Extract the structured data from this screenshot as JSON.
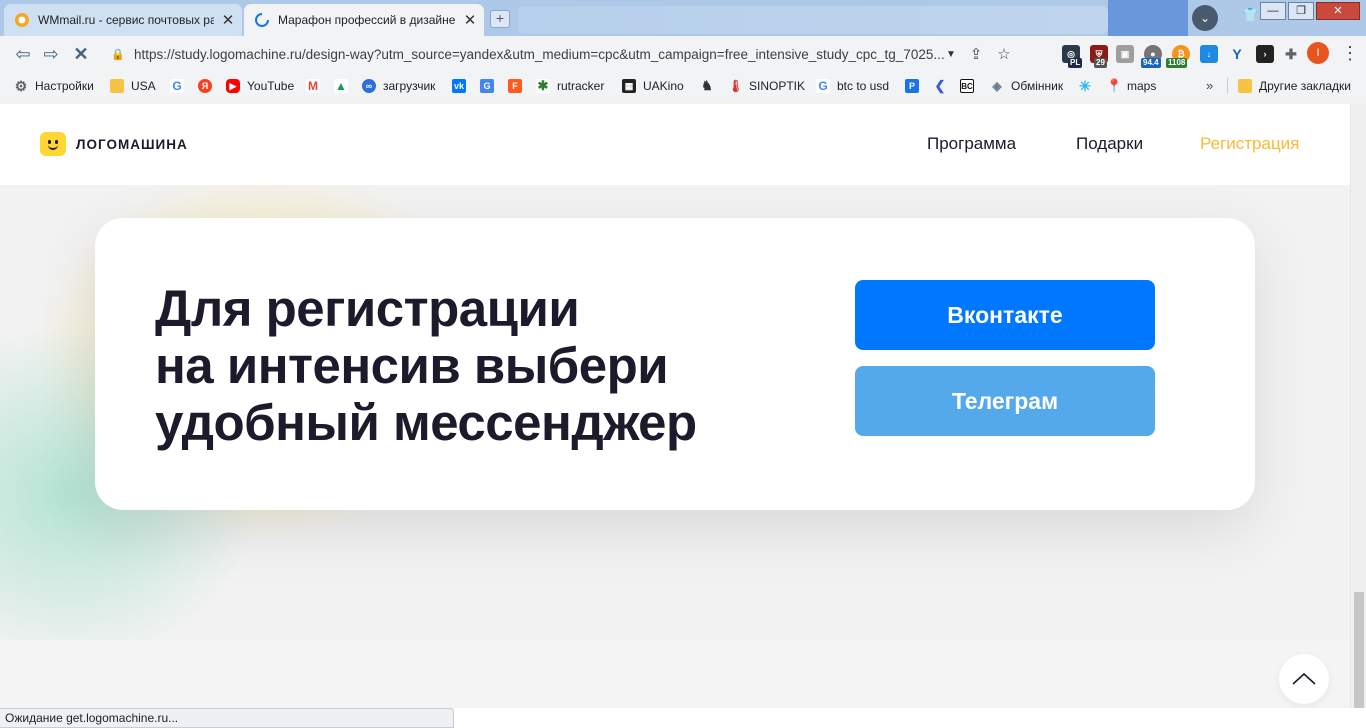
{
  "browser": {
    "tabs": [
      {
        "title": "WMmail.ru - сервис почтовых рассылок",
        "active": false,
        "close": "✕"
      },
      {
        "title": "Марафон профессий в дизайне с нуля",
        "active": true,
        "close": "✕"
      }
    ],
    "new_tab_symbol": "+",
    "window_controls": {
      "minimize": "—",
      "maximize": "❐",
      "close": "✕"
    },
    "nav": {
      "back": "⇦",
      "forward": "⇨",
      "stop": "✕"
    },
    "url": "https://study.logomachine.ru/design-way?utm_source=yandex&utm_medium=cpc&utm_campaign=free_intensive_study_cpc_tg_7025...",
    "extension_badges": {
      "pl": "PL",
      "n29": "29",
      "n94": "94.4",
      "n1108": "1108"
    },
    "profile_initial": "I",
    "bookmarks": [
      {
        "label": "Настройки",
        "icon": "gear-icon",
        "color": "#5f6368"
      },
      {
        "label": "USA",
        "icon": "folder-icon",
        "color": "#f6c342"
      },
      {
        "label": "",
        "icon": "google-icon",
        "color": "#4285f4"
      },
      {
        "label": "",
        "icon": "yandex-icon",
        "color": "#fc3f1d"
      },
      {
        "label": "YouTube",
        "icon": "youtube-icon",
        "color": "#ff0000"
      },
      {
        "label": "",
        "icon": "gmail-icon",
        "color": "#ea4335"
      },
      {
        "label": "",
        "icon": "drive-icon",
        "color": "#0f9d58"
      },
      {
        "label": "загрузчик",
        "icon": "infinity-icon",
        "color": "#2a6fdb"
      },
      {
        "label": "",
        "icon": "vk-icon",
        "color": "#0077ff"
      },
      {
        "label": "",
        "icon": "translate-icon",
        "color": "#4285f4"
      },
      {
        "label": "",
        "icon": "f-icon",
        "color": "#ff5a1f"
      },
      {
        "label": "rutracker",
        "icon": "rutracker-icon",
        "color": "#2e7d32"
      },
      {
        "label": "UAKino",
        "icon": "uakino-icon",
        "color": "#222222"
      },
      {
        "label": "",
        "icon": "chess-icon",
        "color": "#333333"
      },
      {
        "label": "SINOPTIK",
        "icon": "thermometer-icon",
        "color": "#d32f2f"
      },
      {
        "label": "btc to usd",
        "icon": "google-icon",
        "color": "#4285f4"
      },
      {
        "label": "",
        "icon": "p-icon",
        "color": "#1a73e8"
      },
      {
        "label": "",
        "icon": "arrow-icon",
        "color": "#3b5bdb"
      },
      {
        "label": "",
        "icon": "bc-icon",
        "color": "#111111"
      },
      {
        "label": "Обмінник",
        "icon": "exchange-icon",
        "color": "#607d8b"
      },
      {
        "label": "",
        "icon": "asterisk-icon",
        "color": "#29b6f6"
      },
      {
        "label": "maps",
        "icon": "maps-icon",
        "color": "#34a853"
      }
    ],
    "bookmarks_more": "»",
    "other_bookmarks": "Другие закладки",
    "status_text": "Ожидание get.logomachine.ru..."
  },
  "site": {
    "logo_text": "ЛОГОМАШИНА",
    "nav": [
      {
        "label": "Программа"
      },
      {
        "label": "Подарки"
      },
      {
        "label": "Регистрация",
        "accent": "#f9b934"
      }
    ],
    "card": {
      "title_lines": [
        "Для регистрации",
        "на интенсив выбери",
        "удобный мессенджер"
      ],
      "vk_button": "Вконтакте",
      "tg_button": "Телеграм",
      "vk_color": "#0077ff",
      "tg_color": "#54a9eb"
    }
  }
}
